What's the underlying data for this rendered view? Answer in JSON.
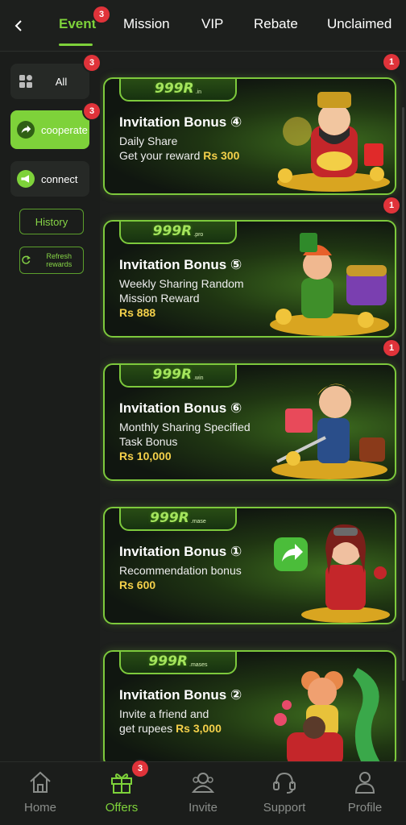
{
  "header": {
    "tabs": [
      {
        "label": "Event",
        "badge": "3"
      },
      {
        "label": "Mission"
      },
      {
        "label": "VIP"
      },
      {
        "label": "Rebate"
      },
      {
        "label": "Unclaimed"
      }
    ]
  },
  "sidebar": {
    "all": {
      "label": "All",
      "badge": "3"
    },
    "cooperate": {
      "label": "cooperate",
      "badge": "3"
    },
    "connect": {
      "label": "connect"
    },
    "history": "History",
    "refresh": "Refresh rewards"
  },
  "cards": [
    {
      "logo": "999R",
      "logo_suffix": ".in",
      "title": "Invitation Bonus ④",
      "line1": "Daily Share",
      "line2": "Get your reward",
      "amount": "Rs 300",
      "badge": "1"
    },
    {
      "logo": "999R",
      "logo_suffix": ".pro",
      "title": "Invitation Bonus ⑤",
      "line1": "Weekly Sharing Random",
      "line2": "Mission Reward",
      "amount": "Rs 888",
      "badge": "1"
    },
    {
      "logo": "999R",
      "logo_suffix": ".win",
      "title": "Invitation Bonus ⑥",
      "line1": "Monthly Sharing Specified",
      "line2": "Task Bonus",
      "amount": "Rs 10,000",
      "badge": "1"
    },
    {
      "logo": "999R",
      "logo_suffix": ".mase",
      "title": "Invitation Bonus ①",
      "line1": "Recommendation bonus",
      "line2": "",
      "amount": "Rs 600"
    },
    {
      "logo": "999R",
      "logo_suffix": ".mases",
      "title": "Invitation Bonus ②",
      "line1": "Invite a friend and",
      "line2": "get rupees",
      "amount": "Rs 3,000"
    }
  ],
  "bottom_nav": [
    {
      "label": "Home",
      "icon": "home-icon"
    },
    {
      "label": "Offers",
      "icon": "gift-icon",
      "badge": "3"
    },
    {
      "label": "Invite",
      "icon": "invite-icon"
    },
    {
      "label": "Support",
      "icon": "headset-icon"
    },
    {
      "label": "Profile",
      "icon": "profile-icon"
    }
  ],
  "colors": {
    "accent": "#7ed23a",
    "badge": "#e0333a",
    "amount": "#f4d04a",
    "background": "#1d1f1d"
  }
}
